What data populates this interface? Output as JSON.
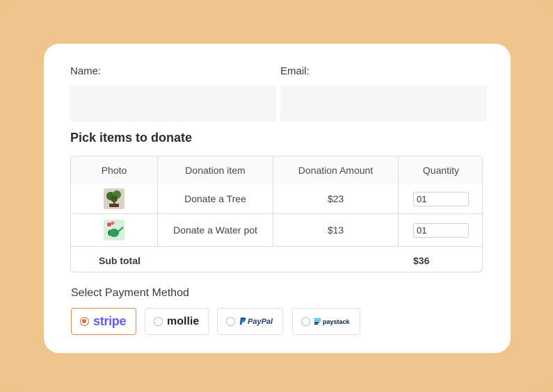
{
  "form": {
    "name_label": "Name:",
    "email_label": "Email:",
    "name_value": "",
    "email_value": ""
  },
  "section_title": "Pick items to donate",
  "table": {
    "headers": [
      "Photo",
      "Donation item",
      "Donation Amount",
      "Quantity"
    ],
    "rows": [
      {
        "photo_icon": "bonsai-tree-photo",
        "item": "Donate a Tree",
        "amount": "$23",
        "quantity": "01"
      },
      {
        "photo_icon": "watering-can-photo",
        "item": "Donate a Water pot",
        "amount": "$13",
        "quantity": "01"
      }
    ],
    "subtotal_label": "Sub total",
    "subtotal_value": "$36"
  },
  "payment": {
    "title": "Select Payment Method",
    "methods": [
      {
        "name": "stripe",
        "selected": true
      },
      {
        "name": "mollie",
        "selected": false
      },
      {
        "name": "PayPal",
        "selected": false
      },
      {
        "name": "paystack",
        "selected": false
      }
    ]
  },
  "colors": {
    "background": "#efc58d",
    "card": "#ffffff",
    "selected_accent": "#e66a2c",
    "stripe": "#635bff"
  }
}
